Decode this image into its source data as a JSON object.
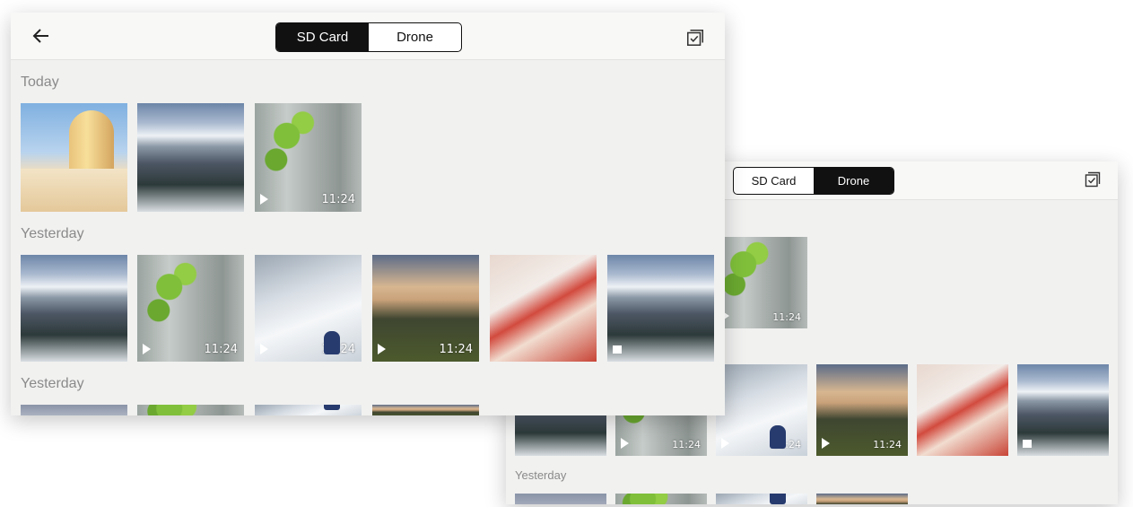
{
  "front_window": {
    "segmented_control": {
      "options": [
        "SD Card",
        "Drone"
      ],
      "active": "SD Card"
    },
    "sections": [
      {
        "label": "Today",
        "items": [
          {
            "image": "building-photo",
            "video": false
          },
          {
            "image": "mountain-photo",
            "video": false
          },
          {
            "image": "ivy-wall-video",
            "video": true,
            "duration": "11:24"
          }
        ]
      },
      {
        "label": "Yesterday",
        "items": [
          {
            "image": "mountain-photo",
            "video": false
          },
          {
            "image": "ivy-wall-video",
            "video": true,
            "duration": "11:24"
          },
          {
            "image": "snow-slope-video",
            "video": true,
            "duration": "11:24"
          },
          {
            "image": "sunset-landscape-video",
            "video": true,
            "duration": "11:24"
          },
          {
            "image": "gift-box-photo",
            "video": false
          },
          {
            "image": "mountain-panorama",
            "video": false,
            "badge": "square"
          }
        ]
      },
      {
        "label": "Yesterday"
      }
    ]
  },
  "back_window": {
    "segmented_control": {
      "options": [
        "SD Card",
        "Drone"
      ],
      "active": "Drone"
    },
    "items_row": [
      {
        "image": "ivy-wall-video",
        "video": true,
        "duration": "11:24"
      },
      {
        "image": "mountain-photo",
        "video": false
      },
      {
        "image": "ivy-wall-video",
        "video": true,
        "duration": "11:24"
      },
      {
        "image": "snow-slope-video",
        "video": true,
        "duration": "11:24"
      },
      {
        "image": "sunset-landscape-video",
        "video": true,
        "duration": "11:24"
      },
      {
        "image": "gift-box-photo",
        "video": false
      },
      {
        "image": "mountain-panorama",
        "video": false,
        "badge": "square"
      }
    ],
    "sections": [
      {
        "label": "Yesterday"
      }
    ]
  },
  "icons": {
    "back": "arrow-left-icon",
    "select": "select-checkbox-icon"
  },
  "colors": {
    "active_segment_bg": "#111111",
    "background": "#f1f1f0"
  }
}
